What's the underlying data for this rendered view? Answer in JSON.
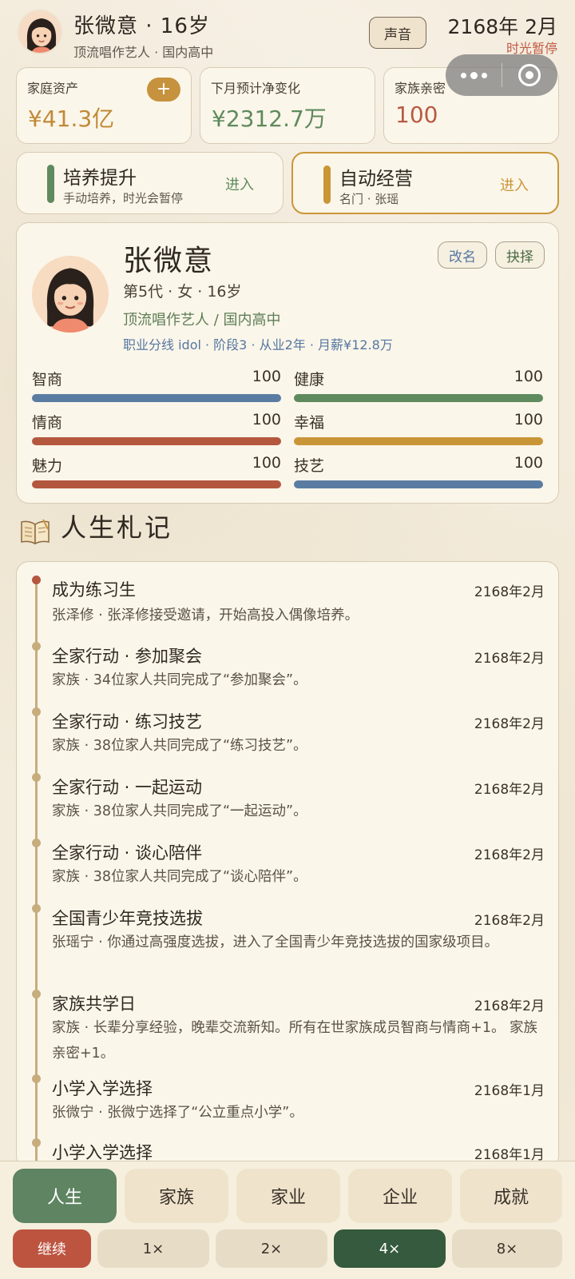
{
  "header": {
    "name_age": "张微意 · 16岁",
    "subtitle": "顶流唱作艺人 · 国内高中",
    "sound_label": "声音",
    "date": "2168年 2月",
    "paused_label": "时光暂停"
  },
  "stats": {
    "assets_label": "家庭资产",
    "assets_value": "¥41.3亿",
    "add_label": "+",
    "net_label": "下月预计净变化",
    "net_value": "¥2312.7万",
    "intimacy_label": "家族亲密",
    "intimacy_value": "100"
  },
  "modes": {
    "train_title": "培养提升",
    "train_sub": "手动培养，时光会暂停",
    "train_go": "进入",
    "auto_title": "自动经营",
    "auto_sub": "名门 · 张瑶",
    "auto_go": "进入"
  },
  "profile": {
    "name": "张微意",
    "line1": "第5代 · 女 · 16岁",
    "line2": "顶流唱作艺人 / 国内高中",
    "line3": "职业分线 idol · 阶段3 · 从业2年 · 月薪¥12.8万",
    "rename_label": "改名",
    "choose_label": "抉择",
    "attrs": [
      {
        "label": "智商",
        "value": "100",
        "color": "#5a7ca2"
      },
      {
        "label": "健康",
        "value": "100",
        "color": "#5e8a5d"
      },
      {
        "label": "情商",
        "value": "100",
        "color": "#b4573f"
      },
      {
        "label": "幸福",
        "value": "100",
        "color": "#c99637"
      },
      {
        "label": "魅力",
        "value": "100",
        "color": "#b4573f"
      },
      {
        "label": "技艺",
        "value": "100",
        "color": "#5a7ca2"
      }
    ]
  },
  "life_log": {
    "title": "人生札记",
    "entries": [
      {
        "title": "成为练习生",
        "date": "2168年2月",
        "desc": "张泽修 · 张泽修接受邀请，开始高投入偶像培养。"
      },
      {
        "title": "全家行动 · 参加聚会",
        "date": "2168年2月",
        "desc": "家族 · 34位家人共同完成了“参加聚会”。"
      },
      {
        "title": "全家行动 · 练习技艺",
        "date": "2168年2月",
        "desc": "家族 · 38位家人共同完成了“练习技艺”。"
      },
      {
        "title": "全家行动 · 一起运动",
        "date": "2168年2月",
        "desc": "家族 · 38位家人共同完成了“一起运动”。"
      },
      {
        "title": "全家行动 · 谈心陪伴",
        "date": "2168年2月",
        "desc": "家族 · 38位家人共同完成了“谈心陪伴”。"
      },
      {
        "title": "全国青少年竞技选拔",
        "date": "2168年2月",
        "desc": "张瑶宁 · 你通过高强度选拔，进入了全国青少年竞技选拔的国家级项目。"
      },
      {
        "title": "家族共学日",
        "date": "2168年2月",
        "desc": "家族 · 长辈分享经验，晚辈交流新知。所有在世家族成员智商与情商+1。 家族亲密+1。"
      },
      {
        "title": "小学入学选择",
        "date": "2168年1月",
        "desc": "张微宁 · 张微宁选择了“公立重点小学”。"
      },
      {
        "title": "小学入学选择",
        "date": "2168年1月",
        "desc": ""
      }
    ]
  },
  "tabs": [
    "人生",
    "家族",
    "家业",
    "企业",
    "成就"
  ],
  "speeds": {
    "continue_label": "继续",
    "options": [
      "1×",
      "2×",
      "4×",
      "8×"
    ]
  }
}
